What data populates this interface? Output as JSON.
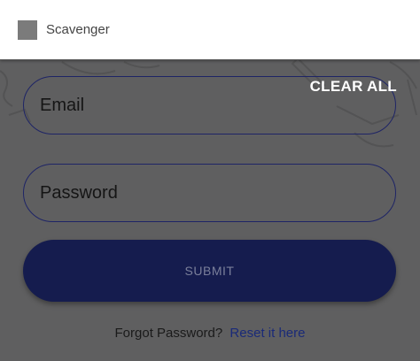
{
  "app": {
    "title": "Scavenger",
    "icon": "app-icon"
  },
  "actions": {
    "clear_all": "CLEAR ALL"
  },
  "form": {
    "email_placeholder": "Email",
    "email_value": "",
    "password_placeholder": "Password",
    "password_value": "",
    "submit_label": "SUBMIT"
  },
  "footer": {
    "forgot_text": "Forgot Password?",
    "reset_link": "Reset it here"
  },
  "colors": {
    "primary": "#151c4e",
    "outline": "#1e2466",
    "link": "#1a2a78",
    "scrim": "#5f5f60"
  }
}
